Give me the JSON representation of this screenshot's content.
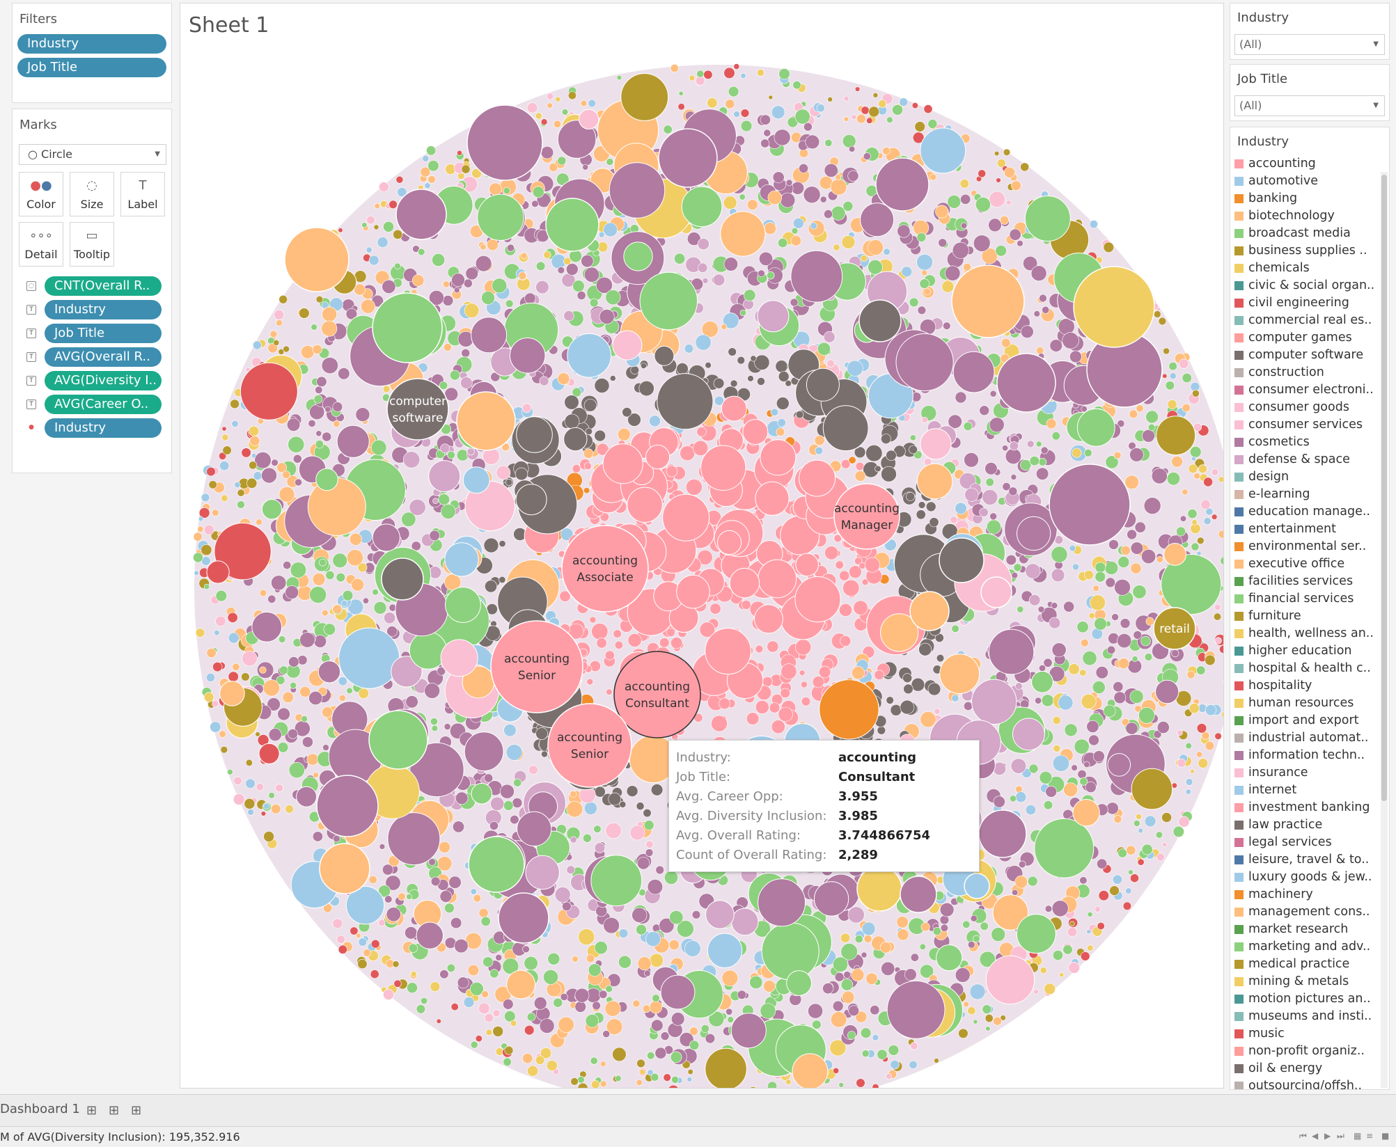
{
  "left": {
    "filters": {
      "title": "Filters",
      "pills": [
        "Industry",
        "Job Title"
      ]
    },
    "marks": {
      "title": "Marks",
      "mark_type": "Circle",
      "buttons": {
        "color": "Color",
        "size": "Size",
        "label": "Label",
        "detail": "Detail",
        "tooltip": "Tooltip"
      },
      "fields": [
        {
          "icon": "size-icon",
          "label": "CNT(Overall R..",
          "color": "green"
        },
        {
          "icon": "label-icon",
          "label": "Industry",
          "color": "blue"
        },
        {
          "icon": "label-icon",
          "label": "Job Title",
          "color": "blue"
        },
        {
          "icon": "label-icon",
          "label": "AVG(Overall R..",
          "color": "blue"
        },
        {
          "icon": "label-icon",
          "label": "AVG(Diversity I..",
          "color": "green"
        },
        {
          "icon": "label-icon",
          "label": "AVG(Career O..",
          "color": "green"
        },
        {
          "icon": "color-icon",
          "label": "Industry",
          "color": "blue"
        }
      ]
    }
  },
  "sheet": {
    "title": "Sheet 1"
  },
  "chart_data": {
    "type": "packed-bubble",
    "labeled_bubbles": [
      {
        "text": [
          "computer",
          "software"
        ],
        "industry": "computer software"
      },
      {
        "text": [
          "accounting",
          "Manager"
        ],
        "industry": "accounting"
      },
      {
        "text": [
          "accounting",
          "Associate"
        ],
        "industry": "accounting"
      },
      {
        "text": [
          "accounting",
          "Senior"
        ],
        "industry": "accounting"
      },
      {
        "text": [
          "accounting",
          "Consultant"
        ],
        "industry": "accounting"
      },
      {
        "text": [
          "accounting",
          "Senior"
        ],
        "industry": "accounting"
      },
      {
        "text": [
          "retail"
        ],
        "industry": "retail"
      }
    ]
  },
  "tooltip": {
    "rows": [
      {
        "key": "Industry:",
        "value": "accounting"
      },
      {
        "key": "Job Title:",
        "value": "Consultant"
      },
      {
        "key": "Avg. Career Opp:",
        "value": "3.955"
      },
      {
        "key": "Avg. Diversity Inclusion:",
        "value": "3.985"
      },
      {
        "key": "Avg. Overall Rating:",
        "value": "3.744866754"
      },
      {
        "key": "Count of Overall Rating:",
        "value": "2,289"
      }
    ]
  },
  "right": {
    "filter_industry": {
      "title": "Industry",
      "value": "(All)"
    },
    "filter_job": {
      "title": "Job Title",
      "value": "(All)"
    },
    "legend": {
      "title": "Industry",
      "items": [
        {
          "label": "accounting",
          "color": "#ff9da7"
        },
        {
          "label": "automotive",
          "color": "#a0cbe8"
        },
        {
          "label": "banking",
          "color": "#f28e2b"
        },
        {
          "label": "biotechnology",
          "color": "#ffbe7d"
        },
        {
          "label": "broadcast media",
          "color": "#8cd17d"
        },
        {
          "label": "business supplies ..",
          "color": "#b6992d"
        },
        {
          "label": "chemicals",
          "color": "#f1ce63"
        },
        {
          "label": "civic & social organ..",
          "color": "#499894"
        },
        {
          "label": "civil engineering",
          "color": "#e15759"
        },
        {
          "label": "commercial real es..",
          "color": "#86bcb6"
        },
        {
          "label": "computer games",
          "color": "#ff9d9a"
        },
        {
          "label": "computer software",
          "color": "#79706e"
        },
        {
          "label": "construction",
          "color": "#bab0ac"
        },
        {
          "label": "consumer electroni..",
          "color": "#d37295"
        },
        {
          "label": "consumer goods",
          "color": "#fabfd2"
        },
        {
          "label": "consumer services",
          "color": "#fabfd2"
        },
        {
          "label": "cosmetics",
          "color": "#b07aa1"
        },
        {
          "label": "defense & space",
          "color": "#d4a6c8"
        },
        {
          "label": "design",
          "color": "#86bcb6"
        },
        {
          "label": "e-learning",
          "color": "#d7b5a6"
        },
        {
          "label": "education manage..",
          "color": "#4e79a7"
        },
        {
          "label": "entertainment",
          "color": "#4e79a7"
        },
        {
          "label": "environmental ser..",
          "color": "#f28e2b"
        },
        {
          "label": "executive office",
          "color": "#ffbe7d"
        },
        {
          "label": "facilities services",
          "color": "#59a14f"
        },
        {
          "label": "financial services",
          "color": "#8cd17d"
        },
        {
          "label": "furniture",
          "color": "#b6992d"
        },
        {
          "label": "health, wellness an..",
          "color": "#f1ce63"
        },
        {
          "label": "higher education",
          "color": "#499894"
        },
        {
          "label": "hospital & health c..",
          "color": "#86bcb6"
        },
        {
          "label": "hospitality",
          "color": "#e15759"
        },
        {
          "label": "human resources",
          "color": "#f1ce63"
        },
        {
          "label": "import and export",
          "color": "#59a14f"
        },
        {
          "label": "industrial automat..",
          "color": "#bab0ac"
        },
        {
          "label": "information techn..",
          "color": "#b07aa1"
        },
        {
          "label": "insurance",
          "color": "#fabfd2"
        },
        {
          "label": "internet",
          "color": "#a0cbe8"
        },
        {
          "label": "investment banking",
          "color": "#ff9da7"
        },
        {
          "label": "law practice",
          "color": "#79706e"
        },
        {
          "label": "legal services",
          "color": "#d37295"
        },
        {
          "label": "leisure, travel & to..",
          "color": "#4e79a7"
        },
        {
          "label": "luxury goods & jew..",
          "color": "#a0cbe8"
        },
        {
          "label": "machinery",
          "color": "#f28e2b"
        },
        {
          "label": "management cons..",
          "color": "#ffbe7d"
        },
        {
          "label": "market research",
          "color": "#59a14f"
        },
        {
          "label": "marketing and adv..",
          "color": "#8cd17d"
        },
        {
          "label": "medical practice",
          "color": "#b6992d"
        },
        {
          "label": "mining & metals",
          "color": "#f1ce63"
        },
        {
          "label": "motion pictures an..",
          "color": "#499894"
        },
        {
          "label": "museums and insti..",
          "color": "#86bcb6"
        },
        {
          "label": "music",
          "color": "#e15759"
        },
        {
          "label": "non-profit organiz..",
          "color": "#ff9d9a"
        },
        {
          "label": "oil & energy",
          "color": "#79706e"
        },
        {
          "label": "outsourcing/offsh..",
          "color": "#bab0ac"
        }
      ]
    }
  },
  "bottom": {
    "tab": "Dashboard 1",
    "status": "M of AVG(Diversity Inclusion): 195,352.916"
  }
}
